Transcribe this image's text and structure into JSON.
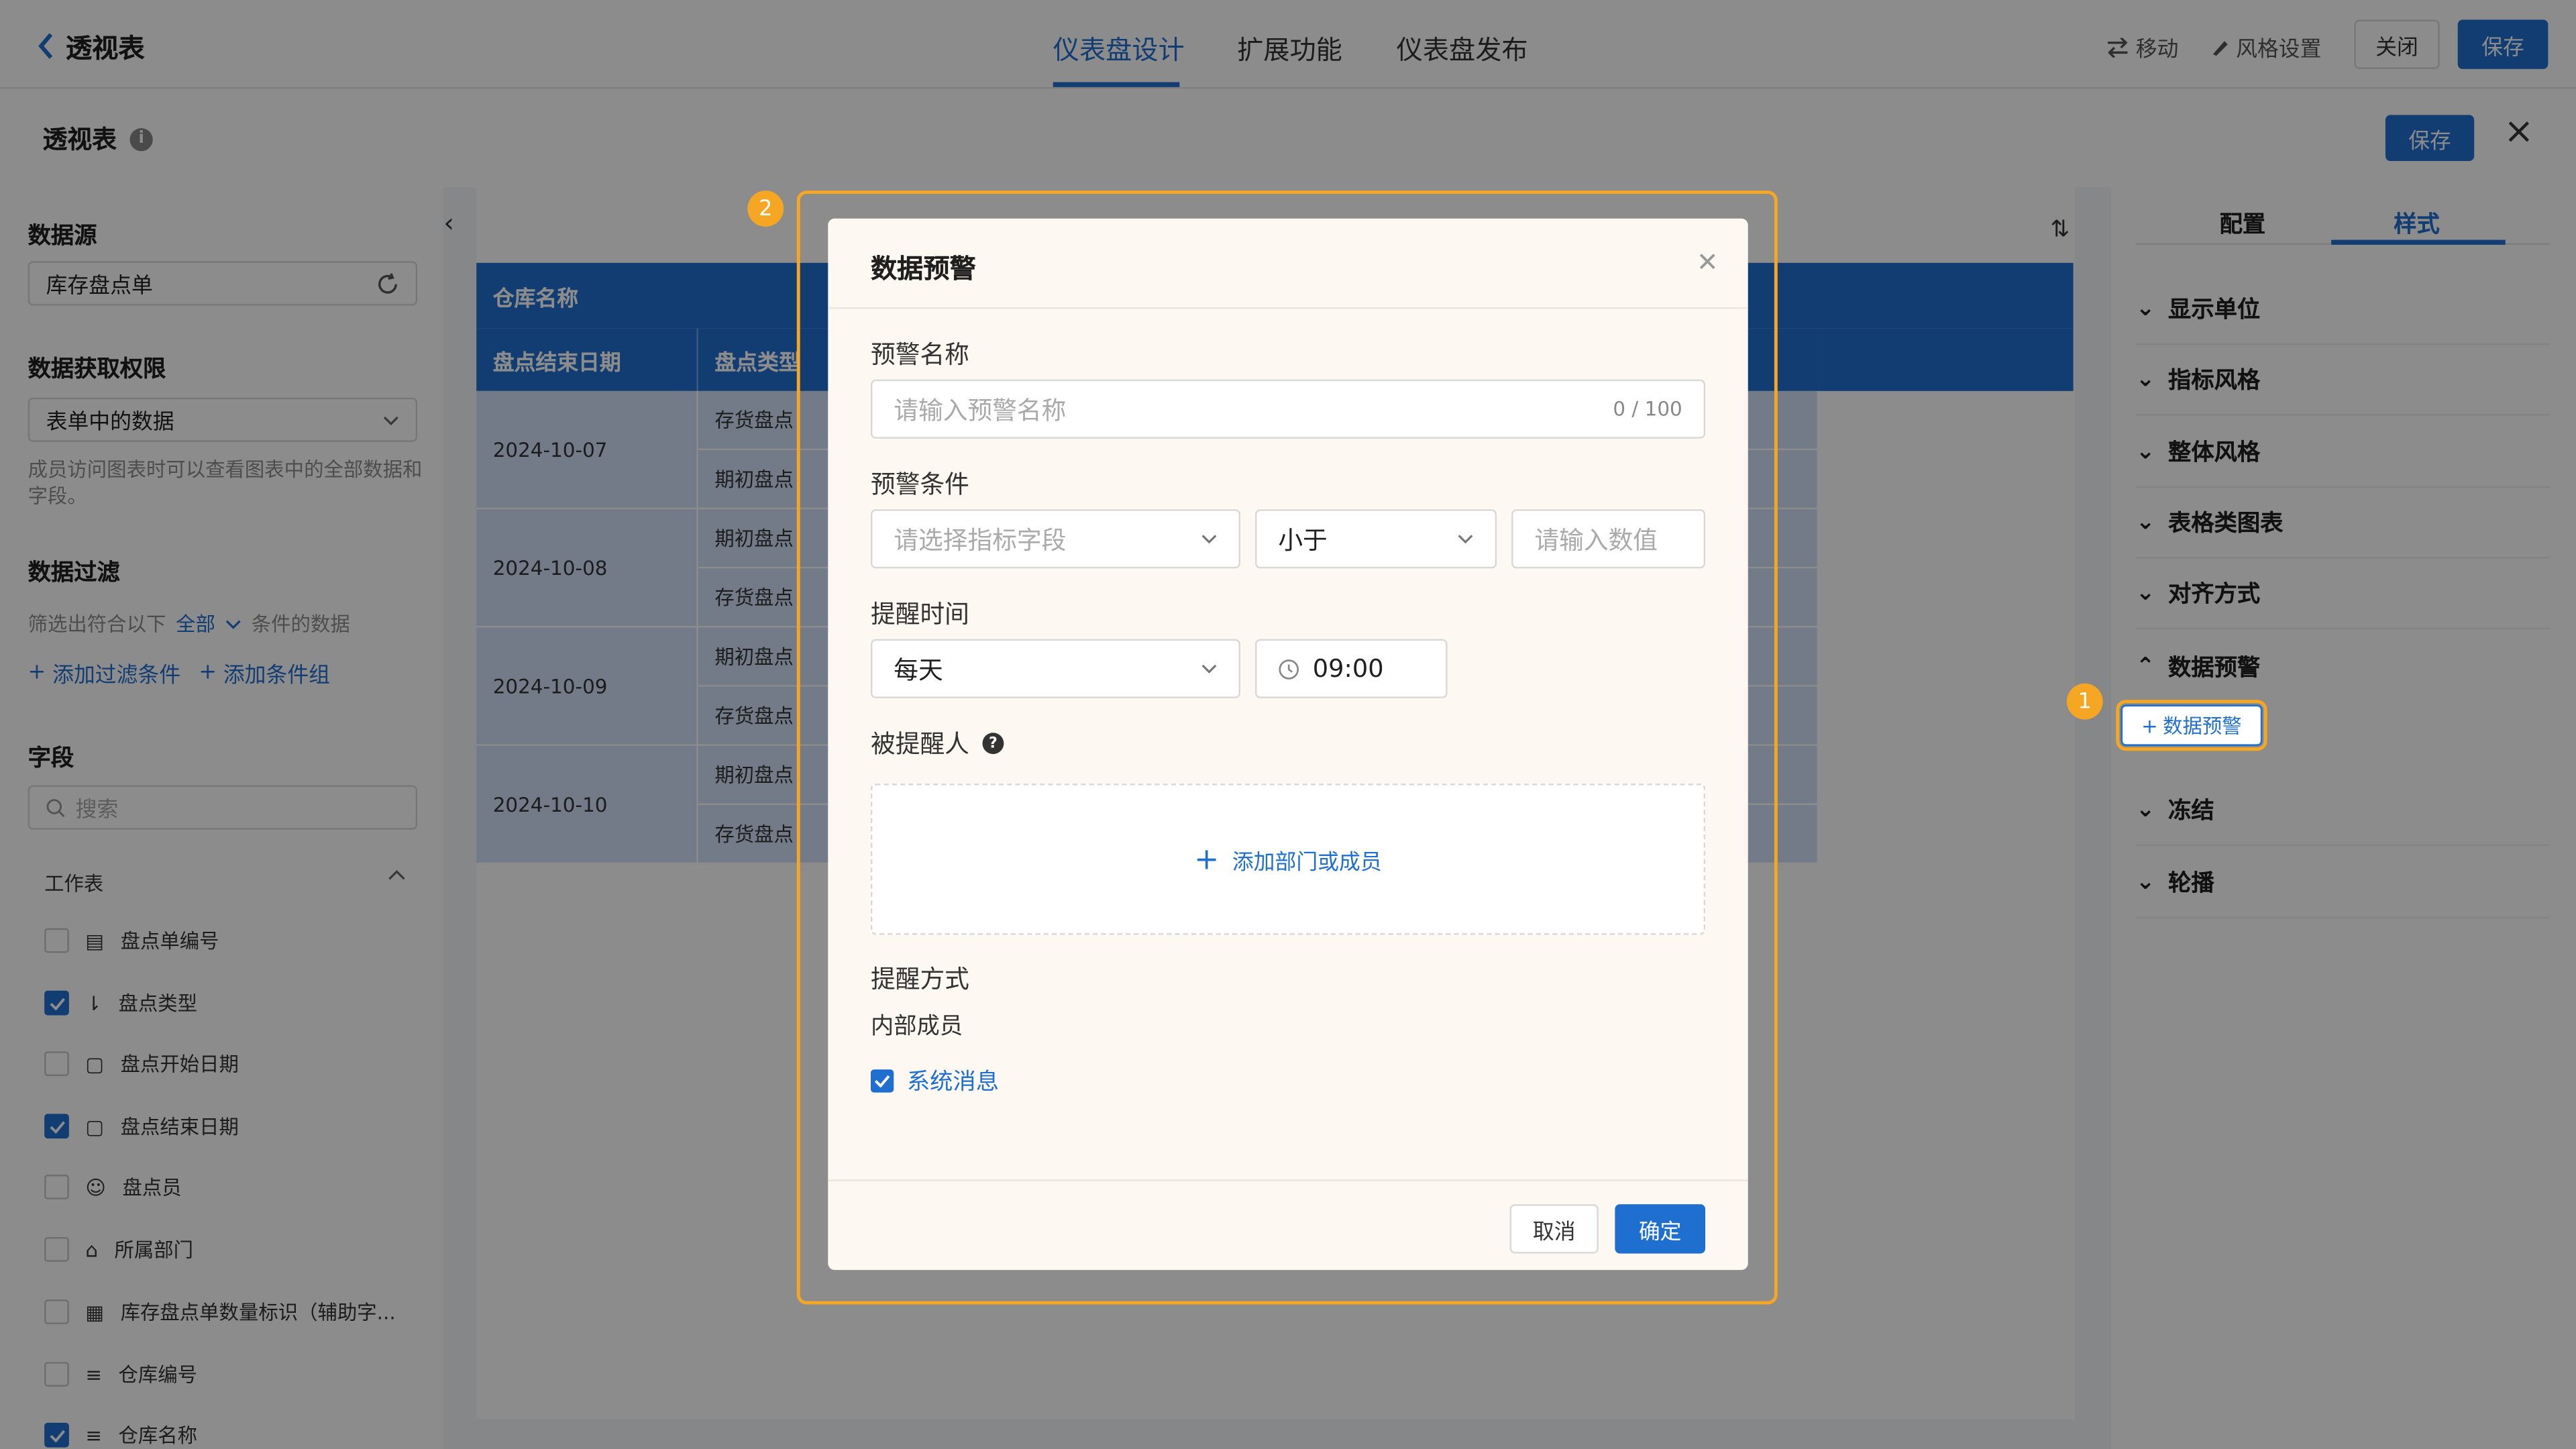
{
  "topbar": {
    "back_label": "透视表",
    "tabs": [
      "仪表盘设计",
      "扩展功能",
      "仪表盘发布"
    ],
    "move_label": "移动",
    "style_label": "风格设置",
    "close_label": "关闭",
    "save_label": "保存"
  },
  "panel": {
    "title": "透视表",
    "info": "i",
    "save_label": "保存",
    "close": "×"
  },
  "left": {
    "datasource_title": "数据源",
    "datasource_value": "库存盘点单",
    "permission_title": "数据获取权限",
    "permission_value": "表单中的数据",
    "permission_hint": "成员访问图表时可以查看图表中的全部数据和字段。",
    "filter_title": "数据过滤",
    "filter_prefix": "筛选出符合以下",
    "filter_all": "全部",
    "filter_suffix": "条件的数据",
    "add_filter": "添加过滤条件",
    "add_group": "添加条件组",
    "fields_title": "字段",
    "search_placeholder": "搜索",
    "worksheet": "工作表",
    "fields": [
      {
        "label": "盘点单编号",
        "checked": false
      },
      {
        "label": "盘点类型",
        "checked": true
      },
      {
        "label": "盘点开始日期",
        "checked": false
      },
      {
        "label": "盘点结束日期",
        "checked": true
      },
      {
        "label": "盘点员",
        "checked": false
      },
      {
        "label": "所属部门",
        "checked": false
      },
      {
        "label": "库存盘点单数量标识（辅助字...",
        "checked": false
      },
      {
        "label": "仓库编号",
        "checked": false
      },
      {
        "label": "仓库名称",
        "checked": true
      }
    ]
  },
  "table": {
    "header_row1": "仓库名称",
    "col1": "盘点结束日期",
    "col2": "盘点类型",
    "dates": [
      "2024-10-07",
      "2024-10-08",
      "2024-10-09",
      "2024-10-10"
    ],
    "types": [
      "存货盘点",
      "期初盘点",
      "期初盘点",
      "存货盘点",
      "期初盘点",
      "存货盘点",
      "期初盘点",
      "存货盘点"
    ]
  },
  "right": {
    "tab_config": "配置",
    "tab_style": "样式",
    "sections": [
      "显示单位",
      "指标风格",
      "整体风格",
      "表格类图表",
      "对齐方式",
      "数据预警"
    ],
    "add_alert": "数据预警",
    "sections_after": [
      "冻结",
      "轮播"
    ]
  },
  "modal": {
    "title": "数据预警",
    "name_label": "预警名称",
    "name_placeholder": "请输入预警名称",
    "name_count": "0 / 100",
    "condition_label": "预警条件",
    "field_placeholder": "请选择指标字段",
    "operator": "小于",
    "value_placeholder": "请输入数值",
    "time_label": "提醒时间",
    "frequency": "每天",
    "time": "09:00",
    "recipient_label": "被提醒人",
    "add_member": "添加部门或成员",
    "method_label": "提醒方式",
    "internal_members": "内部成员",
    "system_message": "系统消息",
    "cancel": "取消",
    "confirm": "确定"
  },
  "annotations": {
    "badge1": "1",
    "badge2": "2",
    "color": "#f5a623"
  }
}
